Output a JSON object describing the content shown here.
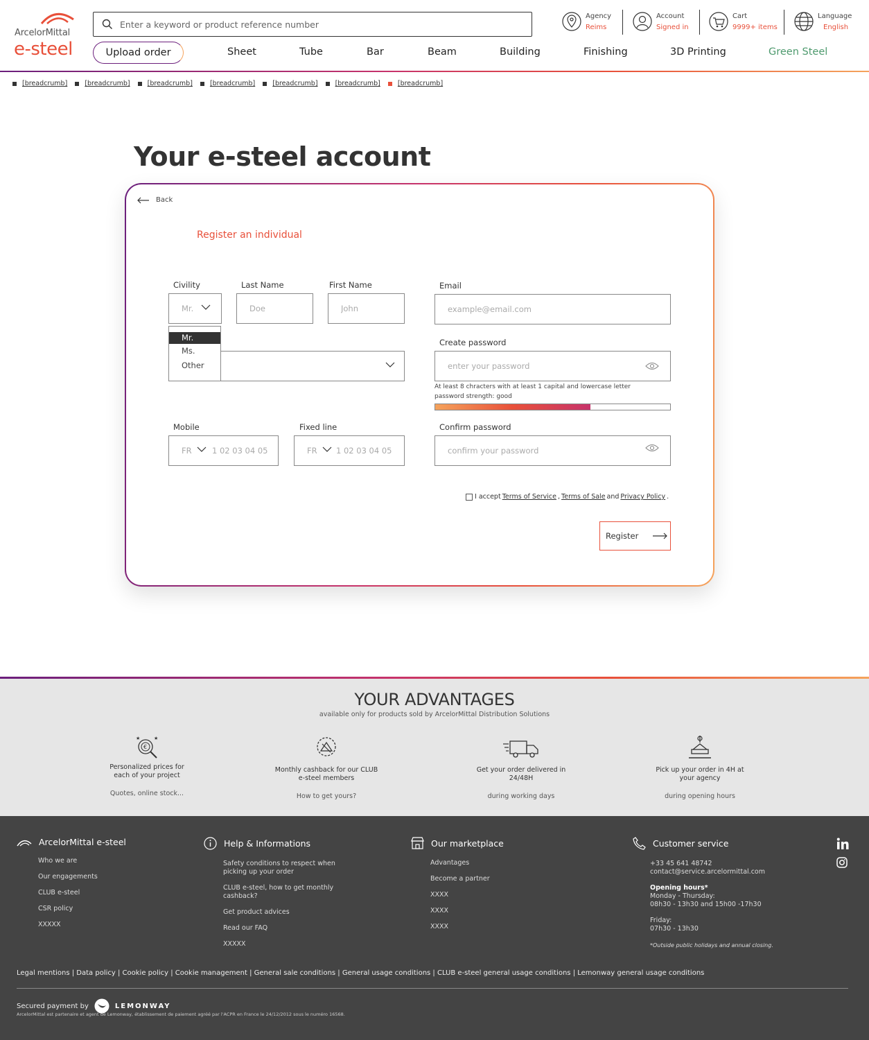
{
  "brand": {
    "company": "ArcelorMittal",
    "product": "e-steel"
  },
  "search": {
    "placeholder": "Enter a keyword or product reference number"
  },
  "utility": {
    "agency": {
      "label": "Agency",
      "value": "Reims"
    },
    "account": {
      "label": "Account",
      "value": "Signed in"
    },
    "cart": {
      "label": "Cart",
      "value": "9999+ items"
    },
    "language": {
      "label": "Language",
      "value": "English"
    }
  },
  "nav": {
    "upload": "Upload order",
    "items": [
      "Sheet",
      "Tube",
      "Bar",
      "Beam",
      "Building",
      "Finishing",
      "3D Printing",
      "Green Steel"
    ]
  },
  "breadcrumbs": [
    "[breadcrumb]",
    "[breadcrumb]",
    "[breadcrumb]",
    "[breadcrumb]",
    "[breadcrumb]",
    "[breadcrumb]",
    "[breadcrumb]"
  ],
  "page": {
    "title": "Your e-steel account"
  },
  "form": {
    "back": "Back",
    "title": "Register an individual",
    "civility": {
      "label": "Civility",
      "value": "Mr.",
      "options": [
        "Mr.",
        "Ms.",
        "Other"
      ]
    },
    "last_name": {
      "label": "Last Name",
      "placeholder": "Doe"
    },
    "first_name": {
      "label": "First Name",
      "placeholder": "John"
    },
    "email": {
      "label": "Email",
      "placeholder": "example@email.com"
    },
    "create_password": {
      "label": "Create password",
      "placeholder": "enter your password"
    },
    "password_hint": "At least 8 chracters with at least 1 capital and lowercase letter",
    "password_strength": "password strength: good",
    "password_strength_level": 0.66,
    "confirm_password": {
      "label": "Confirm password",
      "placeholder": "confirm your password"
    },
    "mobile": {
      "label": "Mobile",
      "country": "FR",
      "placeholder": "1 02 03 04 05"
    },
    "fixed_line": {
      "label": "Fixed line",
      "country": "FR",
      "placeholder": "1 02 03 04 05"
    },
    "terms": {
      "prefix": "I accept",
      "tos": "Terms of Service",
      "sep": ",",
      "tsale": "Terms of Sale",
      "and": "and",
      "privacy": "Privacy Policy",
      "end": "."
    },
    "register": "Register"
  },
  "advantages": {
    "title": "YOUR ADVANTAGES",
    "subtitle": "available only for products sold by ArcelorMittal Distribution Solutions",
    "items": [
      {
        "name": "Personalized prices for each of your project",
        "detail": "Quotes, online stock..."
      },
      {
        "name": "Monthly cashback for our CLUB e-steel members",
        "detail": "How to get yours?"
      },
      {
        "name": "Get your order delivered in 24/48H",
        "detail": "during working days"
      },
      {
        "name": "Pick up your order in 4H at your agency",
        "detail": "during opening hours"
      }
    ]
  },
  "footer": {
    "col1": {
      "title": "ArcelorMittal e-steel",
      "links": [
        "Who we are",
        "Our engagements",
        "CLUB e-steel",
        "CSR policy",
        "XXXXX"
      ]
    },
    "col2": {
      "title": "Help & Informations",
      "links": [
        "Safety conditions to respect when picking up your order",
        "CLUB e-steel, how to get monthly cashback?",
        "Get product advices",
        "Read our FAQ",
        "XXXXX"
      ]
    },
    "col3": {
      "title": "Our marketplace",
      "links": [
        "Advantages",
        "Become a partner",
        "XXXX",
        "XXXX",
        "XXXX"
      ]
    },
    "col4": {
      "title": "Customer service",
      "phone": "+33 45 641 48742",
      "email": "contact@service.arcelormittal.com",
      "hours_title": "Opening hours*",
      "hours_mt": "Monday - Thursday:",
      "hours_mt_val": "08h30 - 13h30 and 15h00 -17h30",
      "hours_f": "Friday:",
      "hours_f_val": "07h30 - 13h30",
      "note": "*Outside public holidays and annual closing."
    },
    "legal": "Legal mentions | Data policy | Cookie policy | Cookie management | General sale conditions | General usage conditions | CLUB e-steel general usage conditions | Lemonway general usage conditions",
    "secured": "Secured payment by",
    "lemonway": "LEMONWAY",
    "disclaimer": "ArcelorMittal est partenaire et agent de Lemonway, établissement de paiement agréé par l'ACPR en France le 24/12/2012 sous le numéro 16568."
  }
}
